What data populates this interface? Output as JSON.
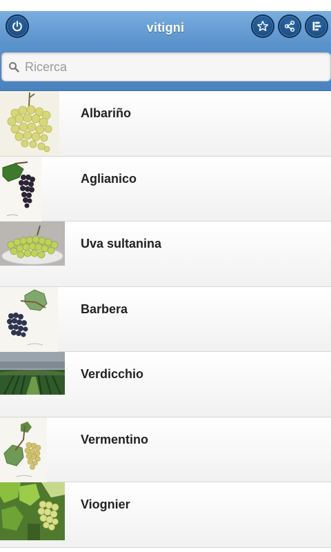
{
  "header": {
    "title": "vitigni",
    "buttons": [
      "power-icon",
      "star-icon",
      "share-icon",
      "list-menu-icon"
    ]
  },
  "search": {
    "placeholder": "Ricerca",
    "value": ""
  },
  "items": [
    {
      "label": "Albariño"
    },
    {
      "label": "Aglianico"
    },
    {
      "label": "Uva sultanina"
    },
    {
      "label": "Barbera"
    },
    {
      "label": "Verdicchio"
    },
    {
      "label": "Vermentino"
    },
    {
      "label": "Viognier"
    }
  ],
  "colors": {
    "header": "#5b93cc",
    "button": "#1c4f86",
    "text": "#222222"
  }
}
